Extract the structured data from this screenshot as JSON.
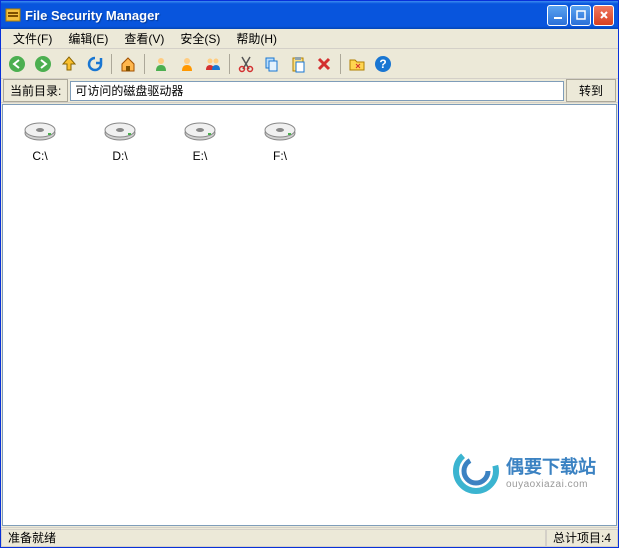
{
  "title": "File Security Manager",
  "menu": {
    "file": "文件(F)",
    "edit": "编辑(E)",
    "view": "查看(V)",
    "security": "安全(S)",
    "help": "帮助(H)"
  },
  "address": {
    "label": "当前目录:",
    "value": "可访问的磁盘驱动器",
    "go": "转到"
  },
  "drives": {
    "c": "C:\\",
    "d": "D:\\",
    "e": "E:\\",
    "f": "F:\\"
  },
  "status": {
    "ready": "准备就绪",
    "count_label": "总计项目:",
    "count": "4"
  },
  "watermark": {
    "cn": "偶要下载站",
    "en": "ouyaoxiazai.com"
  },
  "icons": {
    "back": "back-icon",
    "forward": "forward-icon",
    "up": "up-icon",
    "refresh": "refresh-icon",
    "home": "home-icon",
    "user1": "user-green-icon",
    "user2": "user-orange-icon",
    "users": "users-icon",
    "cut": "cut-icon",
    "copy": "copy-icon",
    "paste": "paste-icon",
    "delete": "delete-icon",
    "folder": "folder-icon",
    "help": "help-icon"
  }
}
